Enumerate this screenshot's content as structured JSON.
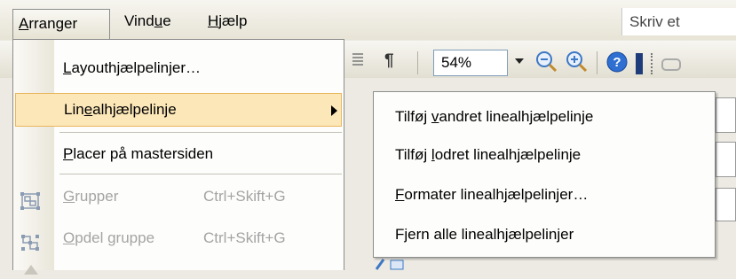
{
  "menubar": {
    "items": [
      {
        "label_pre": "",
        "label_mn": "A",
        "label_post": "rranger"
      },
      {
        "label_pre": "Vind",
        "label_mn": "u",
        "label_post": "e"
      },
      {
        "label_pre": "",
        "label_mn": "H",
        "label_post": "jælp"
      }
    ],
    "ask_placeholder": "Skriv et spørgsmål"
  },
  "toolbar": {
    "zoom_value": "54%",
    "pilcrow_glyph": "¶"
  },
  "main_menu": {
    "items": [
      {
        "label_pre": "",
        "label_mn": "L",
        "label_post": "ayouthjælpelinjer…",
        "shortcut": "",
        "enabled": true
      },
      {
        "label_pre": "Lin",
        "label_mn": "e",
        "label_post": "alhjælpelinje",
        "shortcut": "",
        "enabled": true,
        "has_submenu": true,
        "highlighted": true
      },
      {
        "label_pre": "",
        "label_mn": "P",
        "label_post": "lacer på mastersiden",
        "shortcut": "",
        "enabled": true
      },
      {
        "label_pre": "",
        "label_mn": "G",
        "label_post": "rupper",
        "shortcut": "Ctrl+Skift+G",
        "enabled": false,
        "icon": "group-icon"
      },
      {
        "label_pre": "",
        "label_mn": "O",
        "label_post": "pdel gruppe",
        "shortcut": "Ctrl+Skift+G",
        "enabled": false,
        "icon": "ungroup-icon"
      }
    ]
  },
  "sub_menu": {
    "items": [
      {
        "label_pre": "Tilføj ",
        "label_mn": "v",
        "label_post": "andret linealhjælpelinje"
      },
      {
        "label_pre": "Tilføj ",
        "label_mn": "l",
        "label_post": "odret linealhjælpelinje"
      },
      {
        "label_pre": "",
        "label_mn": "F",
        "label_post": "ormater linealhjælpelinjer…"
      },
      {
        "label_pre": "F",
        "label_mn": "j",
        "label_post": "ern alle linealhjælpelinjer"
      }
    ]
  },
  "colors": {
    "highlight_fill": "#fce7b8",
    "highlight_border": "#e9b65d",
    "disabled_text": "#a4a4a4",
    "menu_border": "#8d8d8d"
  }
}
